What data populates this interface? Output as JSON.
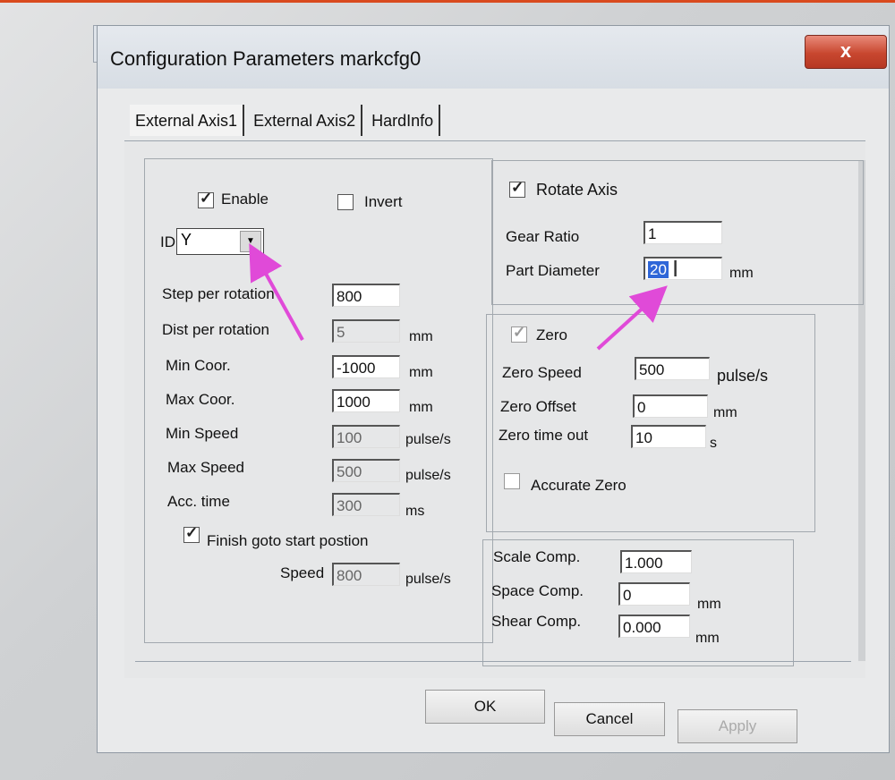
{
  "title": "Configuration Parameters markcfg0",
  "close_glyph": "x",
  "tabs": [
    "External Axis1",
    "External Axis2",
    "HardInfo"
  ],
  "left": {
    "enable": "Enable",
    "invert": "Invert",
    "id_label": "ID",
    "id_value": "Y",
    "rows": [
      {
        "label": "Step per rotation",
        "value": "800",
        "unit": ""
      },
      {
        "label": "Dist per rotation",
        "value": "5",
        "unit": "mm"
      },
      {
        "label": "Min Coor.",
        "value": "-1000",
        "unit": "mm"
      },
      {
        "label": "Max Coor.",
        "value": "1000",
        "unit": "mm"
      },
      {
        "label": "Min Speed",
        "value": "100",
        "unit": "pulse/s"
      },
      {
        "label": "Max Speed",
        "value": "500",
        "unit": "pulse/s"
      },
      {
        "label": "Acc. time",
        "value": "300",
        "unit": "ms"
      }
    ],
    "finish_goto": "Finish goto start postion",
    "speed_label": "Speed",
    "speed_value": "800",
    "speed_unit": "pulse/s"
  },
  "rotate": {
    "label": "Rotate Axis",
    "gear_ratio_label": "Gear Ratio",
    "gear_ratio_value": "1",
    "part_diameter_label": "Part Diameter",
    "part_diameter_value": "20",
    "part_diameter_unit": "mm"
  },
  "zero": {
    "label": "Zero",
    "rows": [
      {
        "label": "Zero Speed",
        "value": "500",
        "unit": "pulse/s"
      },
      {
        "label": "Zero Offset",
        "value": "0",
        "unit": "mm"
      },
      {
        "label": "Zero time out",
        "value": "10",
        "unit": "s"
      }
    ],
    "accurate_zero": "Accurate Zero"
  },
  "comp": {
    "rows": [
      {
        "label": "Scale Comp.",
        "value": "1.000",
        "unit": ""
      },
      {
        "label": "Space Comp.",
        "value": "0",
        "unit": "mm"
      },
      {
        "label": "Shear Comp.",
        "value": "0.000",
        "unit": "mm"
      }
    ]
  },
  "buttons": {
    "ok": "OK",
    "cancel": "Cancel",
    "apply": "Apply"
  },
  "colors": {
    "annotation_arrow": "#e04ad8",
    "selection": "#2e66d8",
    "close": "#c8472f"
  }
}
